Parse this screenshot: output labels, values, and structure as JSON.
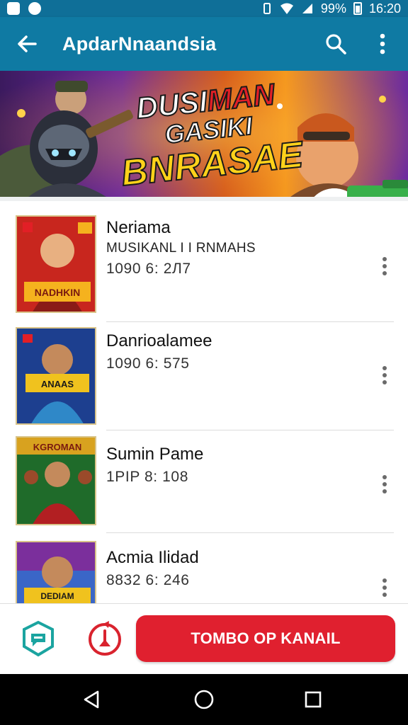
{
  "status_bar": {
    "battery": "99%",
    "time": "16:20"
  },
  "app_bar": {
    "title": "ApdarNnaandsia"
  },
  "banner": {
    "title_line1_a": "DUSI",
    "title_line1_b": "MAN",
    "title_line2": "GASIKI",
    "title_line3": "BNRASAE"
  },
  "list": {
    "items": [
      {
        "name": "Neriama",
        "subtitle": "MUSIKANL I I RNMAHS",
        "meta": "1090 6: 2Л7",
        "thumb_colors": [
          "#c8261e",
          "#f5b21e"
        ]
      },
      {
        "name": "Danrioalamee",
        "subtitle": "",
        "meta": "1090 6: 575",
        "thumb_colors": [
          "#1d3f8f",
          "#2f88c8"
        ]
      },
      {
        "name": "Sumin Pame",
        "subtitle": "",
        "meta": "1PIP 8: 108",
        "thumb_colors": [
          "#1f6b2a",
          "#d8a21f"
        ]
      },
      {
        "name": "Acmia Ilidad",
        "subtitle": "",
        "meta": "8832 6: 246",
        "thumb_colors": [
          "#7b2f9c",
          "#3a66c7"
        ]
      }
    ]
  },
  "bottom_bar": {
    "cta_label": "TOMBO OP KANAIL"
  },
  "colors": {
    "status_bar": "#0f6f98",
    "app_bar": "#0f7aa3",
    "cta": "#e0202f",
    "teal_icon": "#1ba4a0",
    "red_icon": "#d9232e"
  },
  "icons": {
    "back": "arrow-left-icon",
    "search": "search-icon",
    "overflow": "more-vertical-icon",
    "row_menu": "more-vertical-icon",
    "bottom_left": "chat-badge-icon",
    "bottom_mid": "alert-pin-icon",
    "nav_back": "triangle-back-icon",
    "nav_home": "circle-home-icon",
    "nav_recent": "square-recent-icon"
  }
}
